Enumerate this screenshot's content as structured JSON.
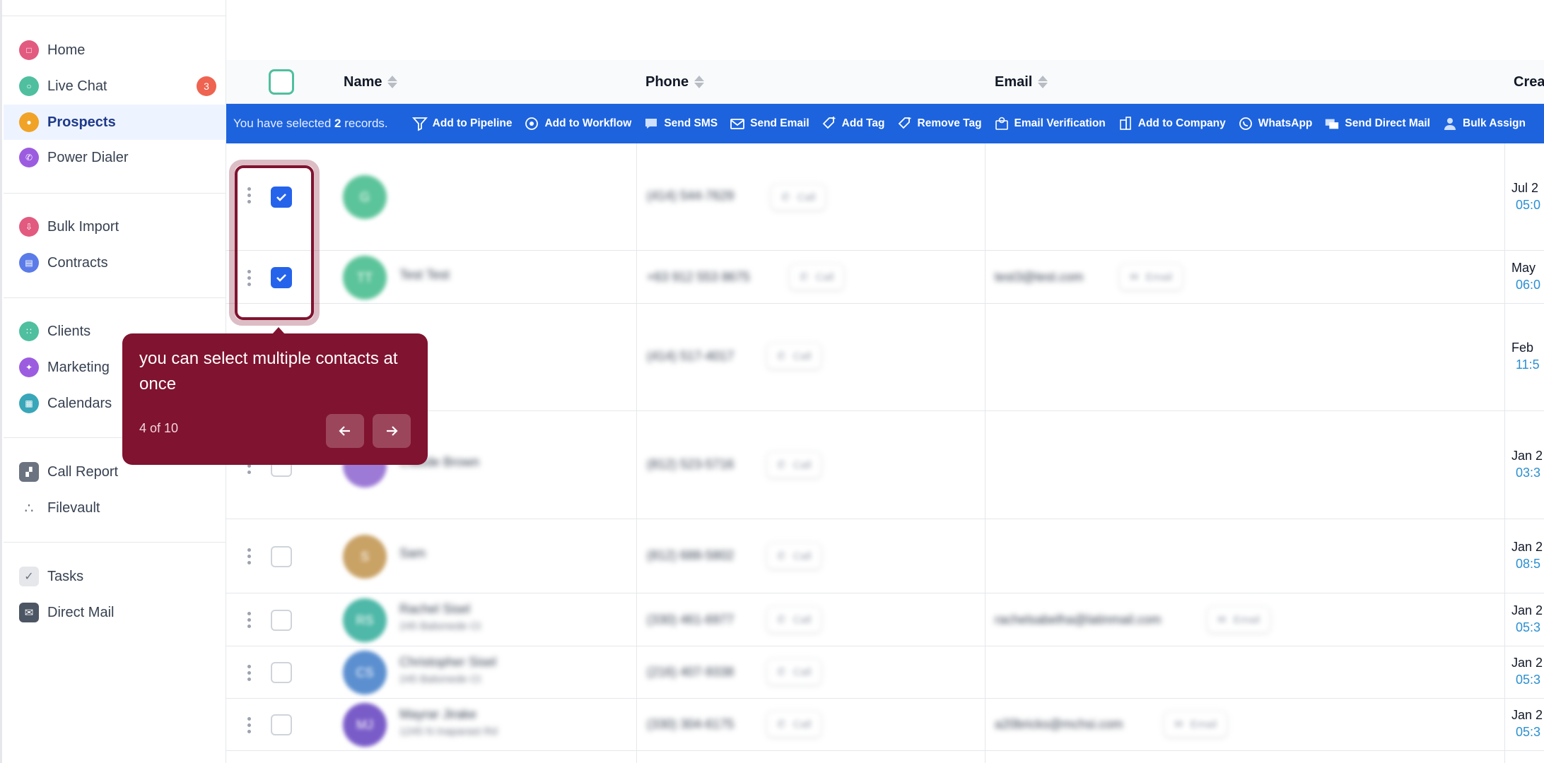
{
  "sidebar": {
    "items": [
      {
        "label": "Home",
        "icon": "home-icon",
        "color": "#e25a7f"
      },
      {
        "label": "Live Chat",
        "icon": "chat-icon",
        "color": "#4fbf9f",
        "badge": "3"
      },
      {
        "label": "Prospects",
        "icon": "prospects-icon",
        "color": "#f0a327",
        "active": true
      },
      {
        "label": "Power Dialer",
        "icon": "phone-icon",
        "color": "#9c5ce0"
      },
      {
        "label": "Bulk Import",
        "icon": "import-icon",
        "color": "#e25a7f"
      },
      {
        "label": "Contracts",
        "icon": "contract-icon",
        "color": "#5b7be8"
      },
      {
        "label": "Clients",
        "icon": "clients-icon",
        "color": "#4fbf9f"
      },
      {
        "label": "Marketing",
        "icon": "marketing-icon",
        "color": "#9c5ce0"
      },
      {
        "label": "Calendars",
        "icon": "calendar-icon",
        "color": "#3aa6b9"
      },
      {
        "label": "Call Report",
        "icon": "report-icon",
        "color": "#6b7280"
      },
      {
        "label": "Filevault",
        "icon": "filevault-icon",
        "color": "#6b7280"
      },
      {
        "label": "Tasks",
        "icon": "tasks-icon",
        "color": "#9ca3af"
      },
      {
        "label": "Direct Mail",
        "icon": "mail-icon",
        "color": "#4b5563"
      }
    ]
  },
  "table": {
    "columns": {
      "name": "Name",
      "phone": "Phone",
      "email": "Email",
      "created": "Crea"
    },
    "bulk": {
      "prefix": "You have selected ",
      "count": "2",
      "suffix": " records.",
      "actions": [
        "Add to Pipeline",
        "Add to Workflow",
        "Send SMS",
        "Send Email",
        "Add Tag",
        "Remove Tag",
        "Email Verification",
        "Add to Company",
        "WhatsApp",
        "Send Direct Mail",
        "Bulk Assign"
      ]
    },
    "rows": [
      {
        "initials": "G",
        "name": "",
        "address": "",
        "phone": "(414) 544-7629",
        "email": "",
        "date": "Jul 2",
        "time": "05:0",
        "checked": true,
        "avatar": "#5cc49a"
      },
      {
        "initials": "TT",
        "name": "Test Test",
        "address": "",
        "phone": "+63 912 553 8675",
        "email": "test3@test.com",
        "date": "May",
        "time": "06:0",
        "checked": true,
        "avatar": "#5cc49a"
      },
      {
        "initials": "",
        "name": "",
        "address": "",
        "phone": "(414) 517-4017",
        "email": "",
        "date": "Feb",
        "time": "11:5",
        "checked": false,
        "avatar": "#5cc49a"
      },
      {
        "initials": "",
        "name": "Claude Brown",
        "address": "",
        "phone": "(812) 523-5716",
        "email": "",
        "date": "Jan 2",
        "time": "03:3",
        "checked": false,
        "avatar": "#9c7ad6"
      },
      {
        "initials": "S",
        "name": "Sam",
        "address": "",
        "phone": "(812) 688-5802",
        "email": "",
        "date": "Jan 2",
        "time": "08:5",
        "checked": false,
        "avatar": "#c9a266"
      },
      {
        "initials": "RS",
        "name": "Rachel Sisel",
        "address": "245 Balsmede Ct",
        "phone": "(330) 461-6977",
        "email": "rachelsabelha@latinmail.com",
        "date": "Jan 2",
        "time": "05:3",
        "checked": false,
        "avatar": "#4fb8a8"
      },
      {
        "initials": "CS",
        "name": "Christopher Sisel",
        "address": "245 Balsmede Ct",
        "phone": "(216) 407-9338",
        "email": "",
        "date": "Jan 2",
        "time": "05:3",
        "checked": false,
        "avatar": "#5b8fd0"
      },
      {
        "initials": "MJ",
        "name": "Mayrar Jirake",
        "address": "1245 N Inaparast Rd",
        "phone": "(330) 304-6175",
        "email": "a20bricks@mchsi.com",
        "date": "Jan 2",
        "time": "05:3",
        "checked": false,
        "avatar": "#7a5cc9"
      }
    ],
    "call_label": "Call",
    "email_label": "Email"
  },
  "tooltip": {
    "message": "you can select multiple contacts at once",
    "step": "4 of 10"
  },
  "colors": {
    "primary": "#1d63dd",
    "tour": "#80132f",
    "active_nav": "#eef4ff"
  }
}
